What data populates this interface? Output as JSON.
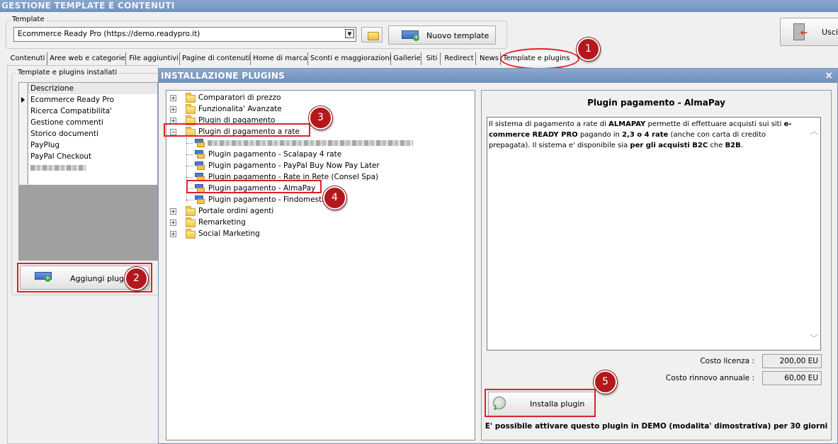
{
  "window": {
    "title": "GESTIONE TEMPLATE E CONTENUTI"
  },
  "template": {
    "group_label": "Template",
    "selected": "Ecommerce Ready Pro (https://demo.readypro.it)",
    "new_button": "Nuovo template"
  },
  "exit_button": "Uscit",
  "tabs": [
    {
      "label": "Contenuti"
    },
    {
      "label": "Aree web e categorie"
    },
    {
      "label": "File aggiuntivi"
    },
    {
      "label": "Pagine di contenuti"
    },
    {
      "label": "Home di marca"
    },
    {
      "label": "Sconti e maggiorazioni"
    },
    {
      "label": "Gallerie"
    },
    {
      "label": "Siti"
    },
    {
      "label": "Redirect"
    },
    {
      "label": "News"
    },
    {
      "label": "Template e plugins"
    }
  ],
  "installed": {
    "group_label": "Template e plugins installati",
    "column_header": "Descrizione",
    "rows": [
      "Ecommerce Ready Pro",
      "Ricerca Compatibilita'",
      "Gestione commenti",
      "Storico documenti",
      "PayPlug",
      "PayPal Checkout"
    ],
    "add_button": "Aggiungi plugin"
  },
  "dialog": {
    "title": "INSTALLAZIONE PLUGINS",
    "close_glyph": "×",
    "tree": {
      "categories_top": [
        "Comparatori di prezzo",
        "Funzionalita' Avanzate",
        "Plugin di pagamento"
      ],
      "expanded_category": "Plugin di pagamento a rate",
      "children": [
        "Plugin pagamento - Scalapay 4 rate",
        "Plugin pagamento - PayPal Buy Now Pay Later",
        "Plugin pagamento - Rate in Rete (Consel Spa)",
        "Plugin pagamento - AlmaPay",
        "Plugin pagamento - Findomestic"
      ],
      "categories_bottom": [
        "Portale ordini agenti",
        "Remarketing",
        "Social Marketing"
      ]
    },
    "detail": {
      "title": "Plugin pagamento - AlmaPay",
      "desc_1": "Il sistema di pagamento a rate di ",
      "desc_2": "ALMAPAY",
      "desc_3": " permette di effettuare acquisti sui siti ",
      "desc_4": "e-commerce READY PRO",
      "desc_5": " pagando in ",
      "desc_6": "2,3 o 4 rate",
      "desc_7": " (anche con carta di credito prepagata). Il sistema e' disponibile sia ",
      "desc_8": "per gli acquisti B2C",
      "desc_9": " che ",
      "desc_10": "B2B",
      "desc_11": ".",
      "license_label": "Costo licenza :",
      "license_value": "200,00 EU",
      "renewal_label": "Costo rinnovo annuale :",
      "renewal_value": "60,00 EU",
      "install_button": "Installa plugin",
      "demo_note": "E' possibile attivare questo plugin in DEMO (modalita' dimostrativa) per 30 giorni"
    }
  },
  "badges": [
    "1",
    "2",
    "3",
    "4",
    "5"
  ],
  "colors": {
    "titlebar": "#7a99c5",
    "highlight": "#e0202a",
    "badge": "#b3181d"
  }
}
